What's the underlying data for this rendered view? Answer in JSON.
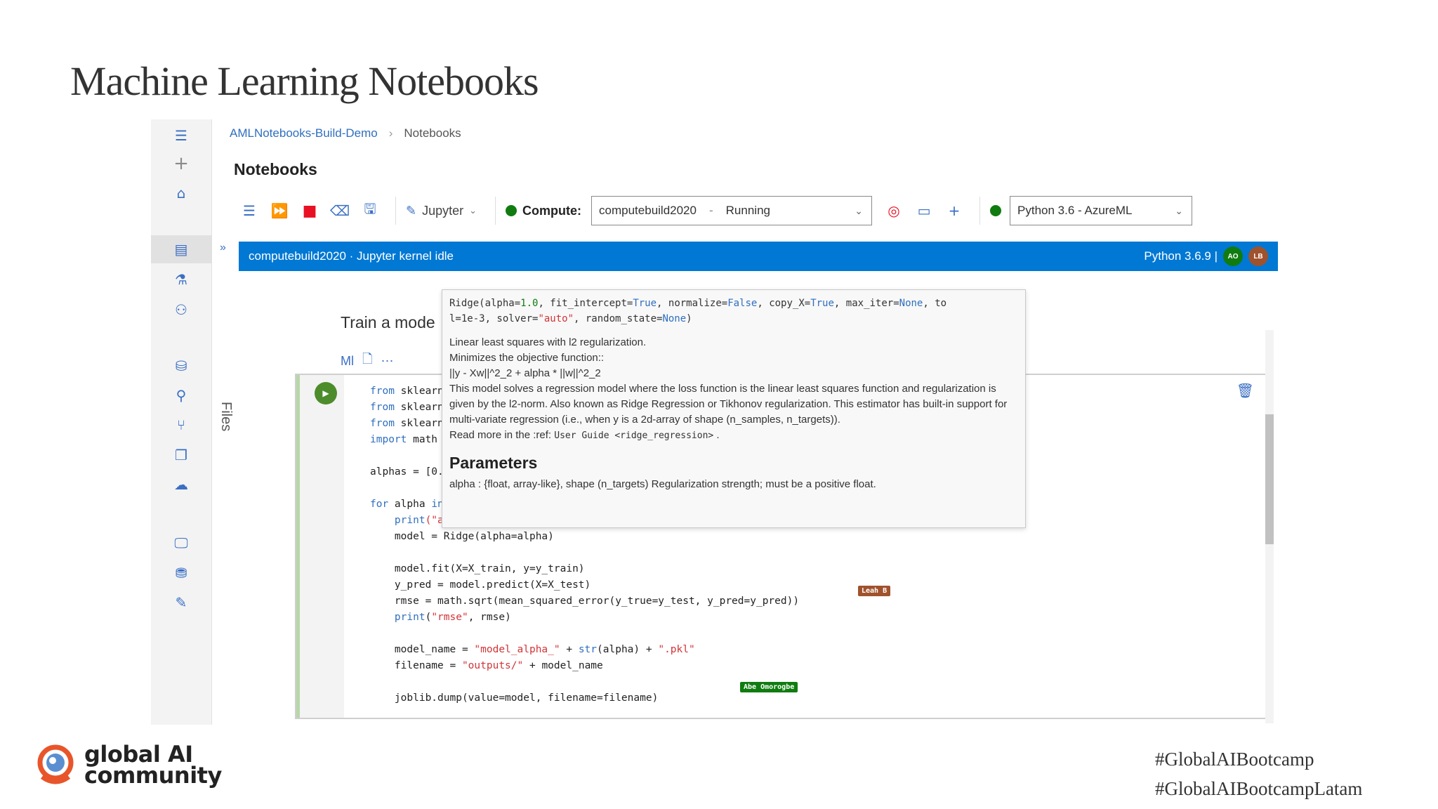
{
  "slide": {
    "title": "Machine Learning Notebooks",
    "hashtags": [
      "#GlobalAIBootcamp",
      "#GlobalAIBootcampLatam"
    ],
    "logo": {
      "line1": "global AI",
      "line2": "community"
    }
  },
  "breadcrumb": {
    "workspace": "AMLNotebooks-Build-Demo",
    "current": "Notebooks"
  },
  "notebook": {
    "title": "Notebooks"
  },
  "toolbar": {
    "jupyter_label": "Jupyter",
    "compute_label": "Compute:",
    "compute_value": "computebuild2020",
    "compute_sep": "-",
    "compute_state": "Running",
    "kernel_value": "Python 3.6 - AzureML"
  },
  "status": {
    "left": "computebuild2020 · Jupyter kernel idle",
    "right": "Python 3.6.9 |",
    "avatars": [
      "AO",
      "LB"
    ]
  },
  "side": {
    "files_label": "Files"
  },
  "cell": {
    "heading": "Train a mode",
    "md_label": "Ml",
    "lines": {
      "l1a": "from",
      "l1b": " sklearn",
      "l2a": "from",
      "l2b": " sklearn",
      "l3a": "from",
      "l3b": " sklearn",
      "l4a": "import",
      "l4b": " math",
      "l5": "alphas = [0.",
      "l6a": "for",
      "l6b": " alpha ",
      "l6c": "in",
      "l7a": "    print",
      "l7b": "(\"a",
      "l8": "    model = Ridge(alpha=alpha)",
      "l9": "    model.fit(X=X_train, y=y_train)",
      "l10": "    y_pred = model.predict(X=X_test)",
      "l11": "    rmse = math.sqrt(mean_squared_error(y_true=y_test, y_pred=y_pred))",
      "l12a": "    print",
      "l12b": "(",
      "l12c": "\"rmse\"",
      "l12d": ", rmse)",
      "l13a": "    model_name = ",
      "l13b": "\"model_alpha_\"",
      "l13c": " + ",
      "l13d": "str",
      "l13e": "(alpha) + ",
      "l13f": "\".pkl\"",
      "l14a": "    filename = ",
      "l14b": "\"outputs/\"",
      "l14c": " + model_name",
      "l15": "    joblib.dump(value=model, filename=filename)"
    },
    "cursor_tags": [
      "Leah B",
      "Abe Omorogbe"
    ]
  },
  "tooltip": {
    "sig_a": "Ridge(alpha=",
    "sig_b": "1.0",
    "sig_c": ", fit_intercept=",
    "sig_d": "True",
    "sig_e": ", normalize=",
    "sig_f": "False",
    "sig_g": ", copy_X=",
    "sig_h": "True",
    "sig_i": ", max_iter=",
    "sig_j": "None",
    "sig_k": ", to\nl=1e-3, solver=",
    "sig_l": "\"auto\"",
    "sig_m": ", random_state=",
    "sig_n": "None",
    "sig_o": ")",
    "d1": "Linear least squares with l2 regularization.",
    "d2": "Minimizes the objective function::",
    "d3": "||y - Xw||^2_2 + alpha * ||w||^2_2",
    "d4": "This model solves a regression model where the loss function is the linear least squares function and regularization is given by the l2-norm. Also known as Ridge Regression or Tikhonov regularization. This estimator has built-in support for multi-variate regression (i.e., when y is a 2d-array of shape (n_samples, n_targets)).",
    "d5a": "Read more in the :ref:",
    "d5b": "User Guide <ridge_regression>",
    "d5c": ".",
    "params_heading": "Parameters",
    "p1": "alpha : {float, array-like}, shape (n_targets) Regularization strength; must be a positive float."
  },
  "colors": {
    "accent": "#0078d4",
    "running": "#107c10",
    "stop": "#e81123"
  }
}
